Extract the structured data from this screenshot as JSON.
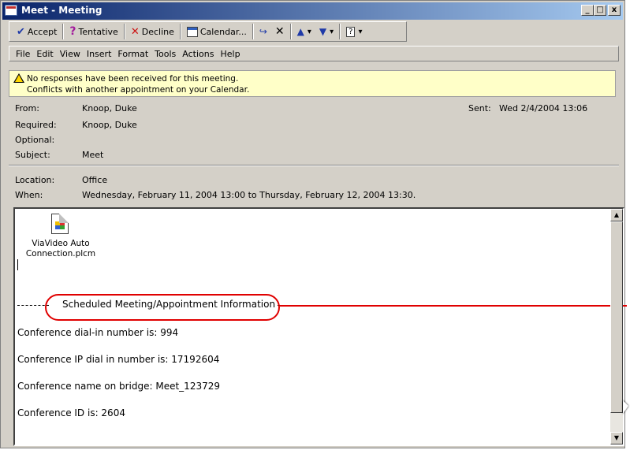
{
  "window": {
    "title": "Meet - Meeting",
    "minimize": "_",
    "maximize": "□",
    "close": "x"
  },
  "toolbar": {
    "accept": "Accept",
    "tentative": "Tentative",
    "decline": "Decline",
    "calendar": "Calendar...",
    "dropdown_glyph": "▾"
  },
  "menu": [
    "File",
    "Edit",
    "View",
    "Insert",
    "Format",
    "Tools",
    "Actions",
    "Help"
  ],
  "infobar": {
    "line1": "No responses have been received for this meeting.",
    "line2": "Conflicts with another appointment on your Calendar."
  },
  "header": {
    "from_label": "From:",
    "from_value": "Knoop, Duke",
    "sent_label": "Sent:",
    "sent_value": "Wed 2/4/2004 13:06",
    "required_label": "Required:",
    "required_value": "Knoop, Duke",
    "optional_label": "Optional:",
    "optional_value": "",
    "subject_label": "Subject:",
    "subject_value": "Meet",
    "location_label": "Location:",
    "location_value": "Office",
    "when_label": "When:",
    "when_value": "Wednesday, February 11, 2004 13:00 to Thursday, February 12, 2004 13:30."
  },
  "body": {
    "attachment_name": "ViaVideo Auto Connection.plcm",
    "section_heading": "Scheduled Meeting/Appointment Information",
    "dial_in": "Conference dial-in number is: 994",
    "ip_dial": "Conference IP dial in number is: 17192604",
    "bridge_name": "Conference name on bridge: Meet_123729",
    "conference_id": "Conference ID is: 2604"
  },
  "icons": [
    "calendar-app-icon",
    "check-icon",
    "question-icon",
    "decline-x-icon",
    "calendar-icon",
    "forward-icon",
    "delete-icon",
    "up-arrow-icon",
    "down-arrow-icon",
    "help-icon",
    "warning-icon",
    "attachment-file-icon"
  ],
  "colors": {
    "highlight_circle": "#e00000",
    "info_bar": "#ffffc8",
    "title_bar_start": "#0a246a"
  }
}
